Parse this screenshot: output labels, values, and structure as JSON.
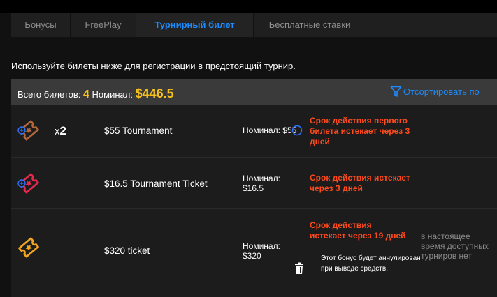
{
  "tabs": [
    {
      "label": "Бонусы",
      "active": false
    },
    {
      "label": "FreePlay",
      "active": false
    },
    {
      "label": "Турнирный билет",
      "active": true
    },
    {
      "label": "Бесплатные ставки",
      "active": false
    }
  ],
  "intro_text": "Используйте билеты ниже для регистрации в предстоящий турнир.",
  "summary": {
    "total_label": "Всего билетов:",
    "total_count": "4",
    "nominal_label": "Номинал:",
    "nominal_value": "$446.5",
    "sort_label": "Отсортировать по"
  },
  "tickets": [
    {
      "icon": "ticket-icon",
      "color": "#b4673a",
      "multiplier_prefix": "x",
      "multiplier": "2",
      "name": "$55 Tournament",
      "nominal": "Номинал: $55",
      "expiry": "Срок действия первого билета истекает через 3 дней"
    },
    {
      "icon": "ticket-icon",
      "color": "#e8294d",
      "name": "$16.5 Tournament Ticket",
      "nominal_label": "Номинал:",
      "nominal_value": "$16.5",
      "expiry": "Срок действия истекает через 3 дней"
    },
    {
      "icon": "ticket-icon",
      "color": "#f3a51d",
      "name": "$320 ticket",
      "nominal_label": "Номинал:",
      "nominal_value": "$320",
      "expiry": "Срок действия истекает через 19 дней",
      "bonus_note": "Этот бонус будет аннулирован при выводе средств.",
      "availability": "в настоящее время доступных турниров нет"
    }
  ],
  "colors": {
    "accent_blue": "#1d8cff",
    "gold": "#f7c21c",
    "expiry_red": "#ff4a1c"
  }
}
